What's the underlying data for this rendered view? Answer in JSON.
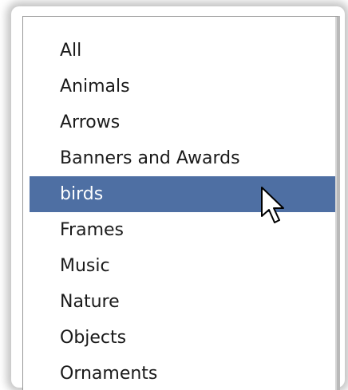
{
  "dropdown": {
    "items": [
      {
        "label": "All"
      },
      {
        "label": "Animals"
      },
      {
        "label": "Arrows"
      },
      {
        "label": "Banners and Awards"
      },
      {
        "label": "birds"
      },
      {
        "label": "Frames"
      },
      {
        "label": "Music"
      },
      {
        "label": "Nature"
      },
      {
        "label": "Objects"
      },
      {
        "label": "Ornaments"
      }
    ],
    "selected_label": "birds",
    "highlight_color": "#4e6fa3"
  },
  "cursor": {
    "icon": "arrow-pointer-icon"
  }
}
